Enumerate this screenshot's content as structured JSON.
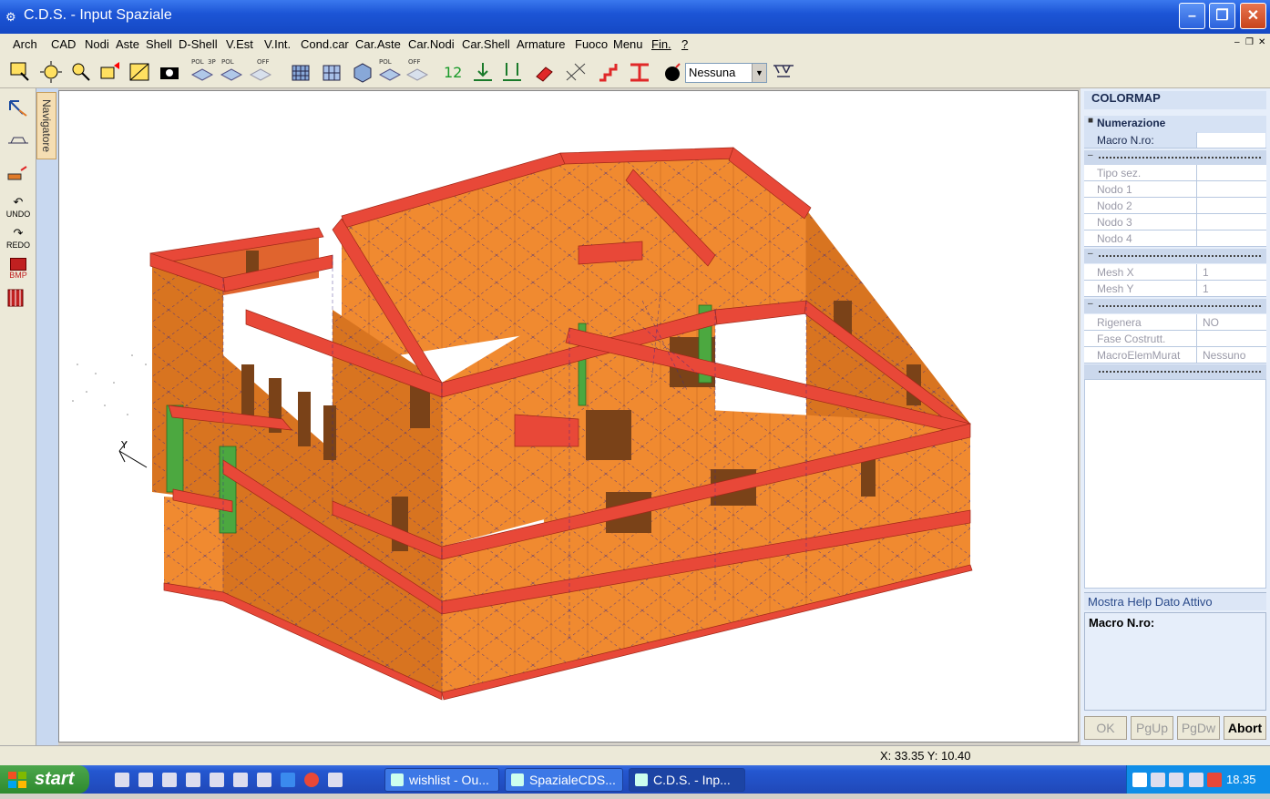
{
  "window": {
    "title": "C.D.S. - Input Spaziale"
  },
  "menu": {
    "items": [
      "Arch",
      "CAD",
      "Nodi",
      "Aste",
      "Shell",
      "D-Shell",
      "V.Est",
      "V.Int.",
      "Cond.car",
      "Car.Aste",
      "Car.Nodi",
      "Car.Shell",
      "Armature",
      "Fuoco",
      "Menu",
      "Fin.",
      "?"
    ]
  },
  "toolbar": {
    "select_value": "Nessuna",
    "tiny_labels": [
      "POL",
      "3P",
      "POL",
      "OFF",
      "POL",
      "OFF"
    ]
  },
  "left_tools": {
    "undo": "UNDO",
    "redo": "REDO",
    "bmp": "BMP"
  },
  "navigator": {
    "label": "Navigatore"
  },
  "colormap": {
    "title": "COLORMAP",
    "numerazione": "Numerazione",
    "macro_label": "Macro N.ro:",
    "fields": [
      {
        "label": "Tipo sez.",
        "value": ""
      },
      {
        "label": "Nodo 1",
        "value": ""
      },
      {
        "label": "Nodo 2",
        "value": ""
      },
      {
        "label": "Nodo 3",
        "value": ""
      },
      {
        "label": "Nodo 4",
        "value": ""
      }
    ],
    "mesh": [
      {
        "label": "Mesh X",
        "value": "1"
      },
      {
        "label": "Mesh Y",
        "value": "1"
      }
    ],
    "other": [
      {
        "label": "Rigenera",
        "value": "NO"
      },
      {
        "label": "Fase Costrutt.",
        "value": ""
      },
      {
        "label": "MacroElemMurat",
        "value": "Nessuno"
      }
    ]
  },
  "help": {
    "title": "Mostra Help Dato Attivo",
    "content": "Macro N.ro:"
  },
  "buttons": {
    "ok": "OK",
    "pgup": "PgUp",
    "pgdw": "PgDw",
    "abort": "Abort"
  },
  "status": {
    "coords": "X: 33.35  Y: 10.40"
  },
  "taskbar": {
    "start": "start",
    "tasks": [
      "wishlist - Ou...",
      "SpazialeCDS...",
      "C.D.S. - Inp..."
    ],
    "clock": "18.35"
  },
  "colors": {
    "wall": "#f08a30",
    "beam": "#e84838",
    "column": "#4ca840",
    "titlebar": "#1c55d6"
  }
}
